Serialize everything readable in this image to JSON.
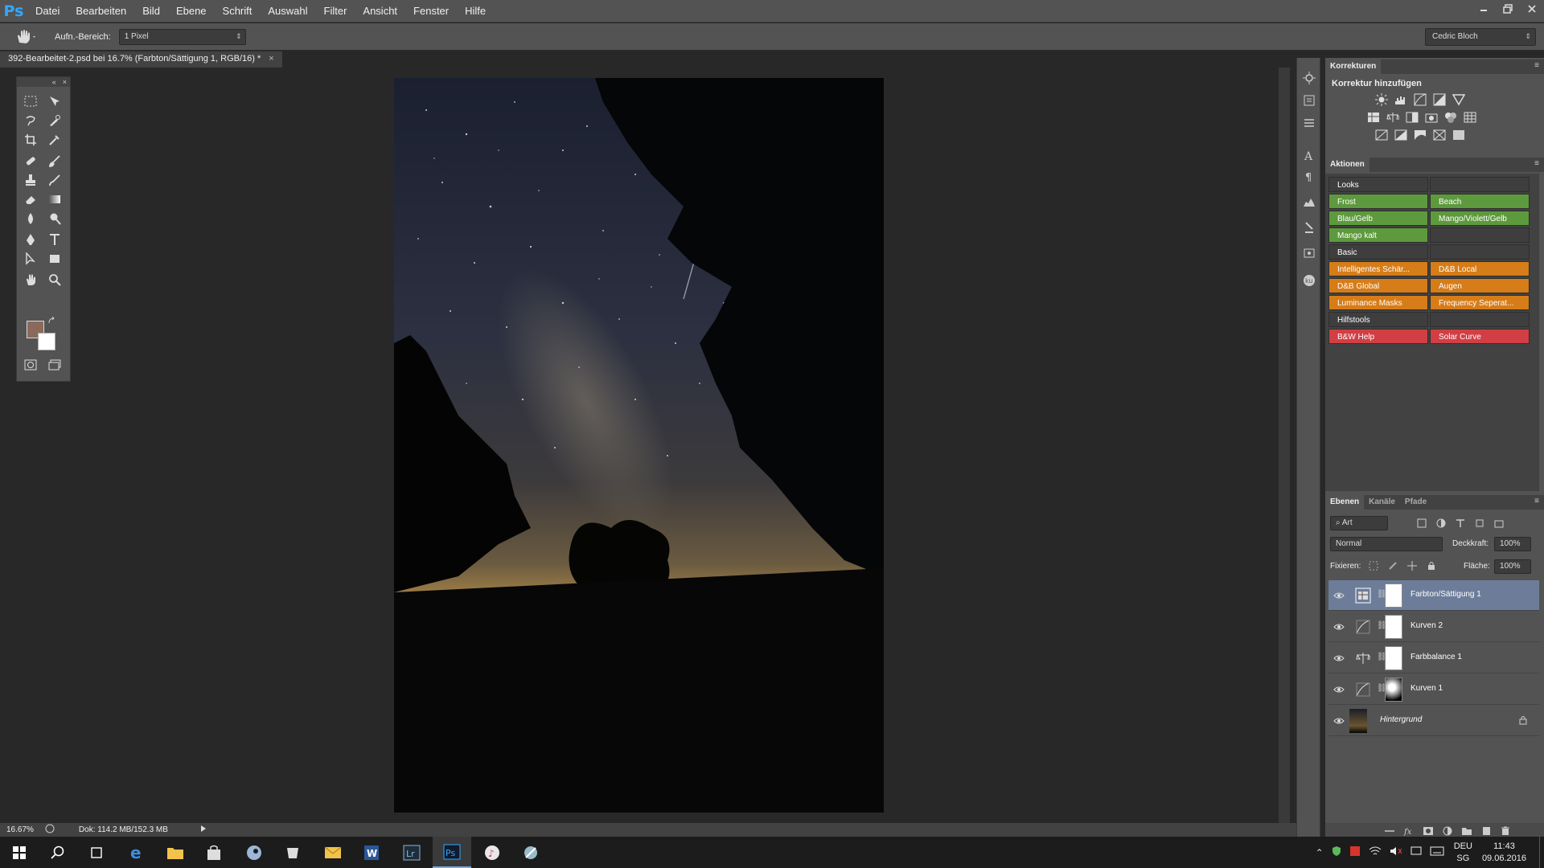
{
  "app": {
    "title": "Ps"
  },
  "menu": [
    "Datei",
    "Bearbeiten",
    "Bild",
    "Ebene",
    "Schrift",
    "Auswahl",
    "Filter",
    "Ansicht",
    "Fenster",
    "Hilfe"
  ],
  "options": {
    "sample_label": "Aufn.-Bereich:",
    "sample_value": "1 Pixel",
    "workspace": "Cedric Bloch"
  },
  "document": {
    "tab_title": "392-Bearbeitet-2.psd bei 16.7% (Farbton/Sättigung 1, RGB/16) *",
    "close": "×"
  },
  "status": {
    "zoom": "16.67%",
    "doc_info": "Dok: 114.2 MB/152.3 MB"
  },
  "colors": {
    "foreground": "#8a6a5a",
    "background": "#ffffff"
  },
  "korrekturen": {
    "tab": "Korrekturen",
    "subtitle": "Korrektur hinzufügen"
  },
  "aktionen": {
    "tab": "Aktionen",
    "rows": [
      [
        {
          "label": "Looks",
          "color": "gray"
        },
        {
          "label": "",
          "color": "gray"
        }
      ],
      [
        {
          "label": "Frost",
          "color": "green"
        },
        {
          "label": "Beach",
          "color": "green"
        }
      ],
      [
        {
          "label": "Blau/Gelb",
          "color": "green"
        },
        {
          "label": "Mango/Violett/Gelb",
          "color": "green"
        }
      ],
      [
        {
          "label": "Mango kalt",
          "color": "green"
        },
        {
          "label": "",
          "color": "gray"
        }
      ],
      [
        {
          "label": "Basic",
          "color": "gray"
        },
        {
          "label": "",
          "color": "gray"
        }
      ],
      [
        {
          "label": "Intelligentes Schär...",
          "color": "orange"
        },
        {
          "label": "D&B Local",
          "color": "orange"
        }
      ],
      [
        {
          "label": "D&B Global",
          "color": "orange"
        },
        {
          "label": "Augen",
          "color": "orange"
        }
      ],
      [
        {
          "label": "Luminance Masks",
          "color": "orange"
        },
        {
          "label": "Frequency Seperat...",
          "color": "orange"
        }
      ],
      [
        {
          "label": "Hilfstools",
          "color": "gray"
        },
        {
          "label": "",
          "color": "gray"
        }
      ],
      [
        {
          "label": "B&W Help",
          "color": "red"
        },
        {
          "label": "Solar Curve",
          "color": "red"
        }
      ]
    ]
  },
  "layers_panel": {
    "tabs": [
      "Ebenen",
      "Kanäle",
      "Pfade"
    ],
    "filter": "Art",
    "blend_mode": "Normal",
    "opacity_label": "Deckkraft:",
    "opacity": "100%",
    "lock_label": "Fixieren:",
    "fill_label": "Fläche:",
    "fill": "100%",
    "layers": [
      {
        "name": "Farbton/Sättigung 1",
        "type": "hue-sat",
        "selected": true
      },
      {
        "name": "Kurven 2",
        "type": "curves",
        "selected": false
      },
      {
        "name": "Farbbalance 1",
        "type": "color-balance",
        "selected": false
      },
      {
        "name": "Kurven 1",
        "type": "curves",
        "selected": false
      },
      {
        "name": "Hintergrund",
        "type": "background",
        "selected": false
      }
    ]
  },
  "taskbar": {
    "lang": "DEU",
    "region": "SG",
    "time": "11:43",
    "date": "09.06.2016"
  }
}
